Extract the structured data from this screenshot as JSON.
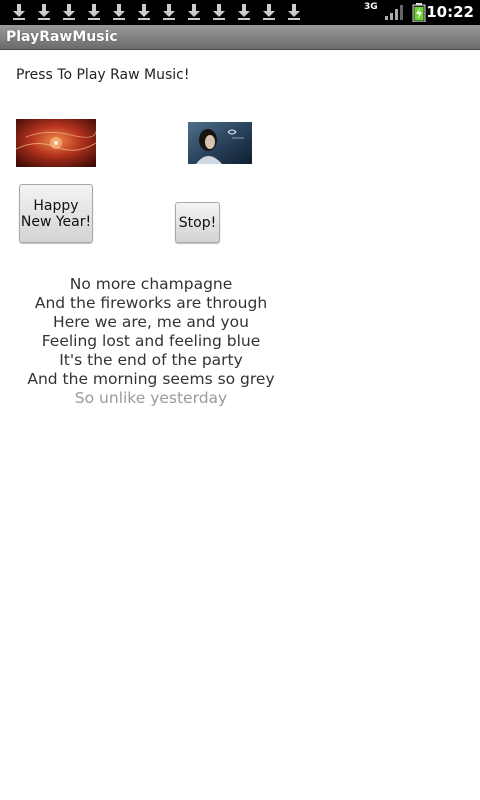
{
  "status_bar": {
    "notification_icons": [
      "download-icon",
      "download-icon",
      "download-icon",
      "download-icon",
      "download-icon",
      "download-icon",
      "download-icon",
      "download-icon",
      "download-icon",
      "download-icon",
      "download-icon",
      "download-icon"
    ],
    "network": "3G",
    "time": "10:22"
  },
  "app": {
    "title": "PlayRawMusic"
  },
  "main": {
    "prompt": "Press To Play Raw Music!",
    "images": [
      {
        "name": "album-art-fireworks"
      },
      {
        "name": "album-art-singer"
      }
    ],
    "buttons": {
      "happy_new_year": "Happy New Year!",
      "stop": "Stop!"
    },
    "lyrics": [
      "No more champagne",
      "And the fireworks are through",
      "Here we are, me and you",
      "Feeling lost and feeling blue",
      "It's the end of the party",
      "And the morning seems so grey",
      "So unlike yesterday"
    ]
  }
}
